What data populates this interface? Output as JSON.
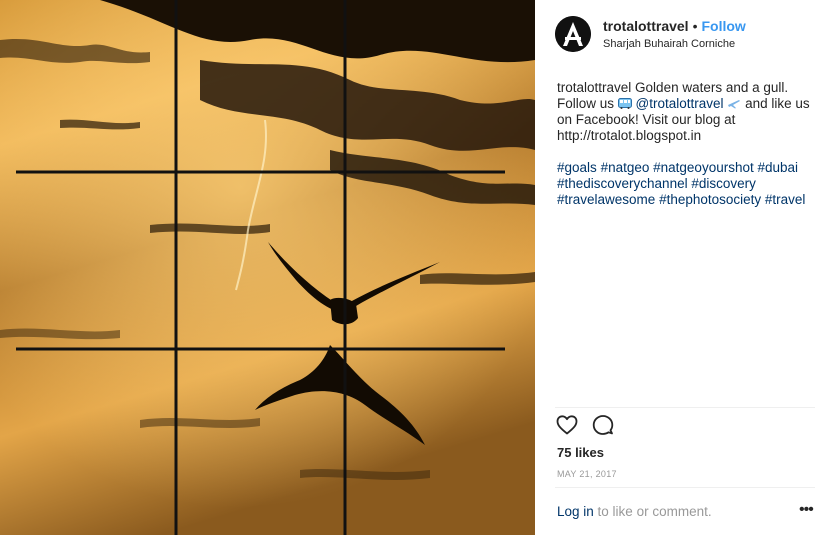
{
  "post": {
    "username": "trotalottravel",
    "separator": "•",
    "follow_label": "Follow",
    "location": "Sharjah Buhairah Corniche"
  },
  "caption": {
    "username": "trotalottravel",
    "text_1": " Golden waters and a gull. Follow us ",
    "mention": "@trotalottravel",
    "text_2": " and like us on Facebook! Visit our blog at http://trotalot.blogspot.in",
    "hashtags": [
      "#goals",
      "#natgeo",
      "#natgeoyourshot",
      "#dubai",
      "#thediscoverychannel",
      "#discovery",
      "#travelawesome",
      "#thephotosociety",
      "#travel"
    ]
  },
  "footer": {
    "like_icon": "heart-outline-icon",
    "comment_icon": "comment-bubble-icon",
    "likes": "75 likes",
    "date": "MAY 21, 2017",
    "login_link": "Log in",
    "login_text": " to like or comment.",
    "more_icon": "ellipsis-icon",
    "more_glyph": "•••"
  },
  "photo": {
    "water_highlight": "#f2b653",
    "water_shadow": "#2a1a06",
    "grid_line_color": "#111111"
  }
}
